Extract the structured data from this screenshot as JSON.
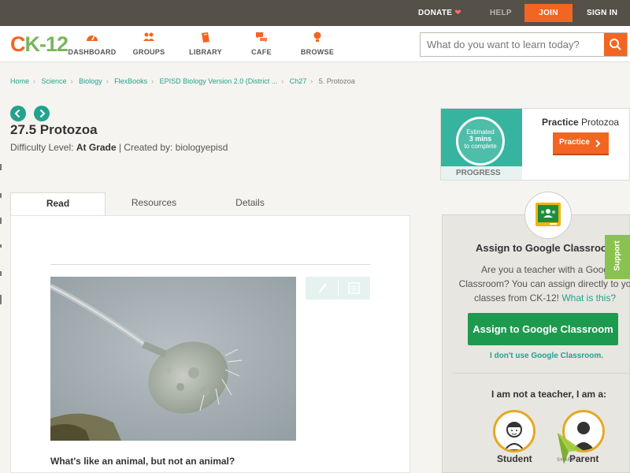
{
  "topbar": {
    "donate": "DONATE",
    "help": "HELP",
    "join": "JOIN",
    "signin": "SIGN IN"
  },
  "header": {
    "logo_c": "C",
    "logo_k": "K-12",
    "nav": [
      {
        "label": "DASHBOARD",
        "icon": "dashboard-icon"
      },
      {
        "label": "GROUPS",
        "icon": "groups-icon"
      },
      {
        "label": "LIBRARY",
        "icon": "library-icon"
      },
      {
        "label": "CAFE",
        "icon": "cafe-icon"
      },
      {
        "label": "BROWSE",
        "icon": "browse-icon"
      }
    ],
    "search_placeholder": "What do you want to learn today?"
  },
  "breadcrumb": [
    "Home",
    "Science",
    "Biology",
    "FlexBooks",
    "EPISD Biology Version 2.0 (District ...",
    "Ch27",
    "5. Protozoa"
  ],
  "article": {
    "title": "27.5 Protozoa",
    "difficulty_label": "Difficulty Level:",
    "difficulty_value": "At Grade",
    "created_by": "| Created by: biologyepisd",
    "tabs": [
      "Read",
      "Resources",
      "Details"
    ],
    "question": "What's like an animal, but not an animal?"
  },
  "practice": {
    "estimated_line1": "Estimated",
    "estimated_line2": "3 mins",
    "estimated_line3": "to complete",
    "progress_label": "PROGRESS",
    "title_bold": "Practice",
    "title_rest": " Protozoa",
    "button": "Practice"
  },
  "assign": {
    "title": "Assign to Google Classroo",
    "text_1": "Are you a teacher with a Goog",
    "text_2": "Classroom? You can assign directly to yo",
    "text_3": "classes from CK-12!",
    "link": "What is this?",
    "button": "Assign to Google Classroom",
    "no_use": "I don't use Google Classroom.",
    "not_teacher": "I am not a teacher, I am a:",
    "student": "Student",
    "parent": "Parent",
    "share": "SHARE",
    "support": "Support"
  },
  "colors": {
    "accent": "#f26522",
    "teal": "#23a28e",
    "green": "#1d9a4e",
    "topbar": "#555149"
  }
}
